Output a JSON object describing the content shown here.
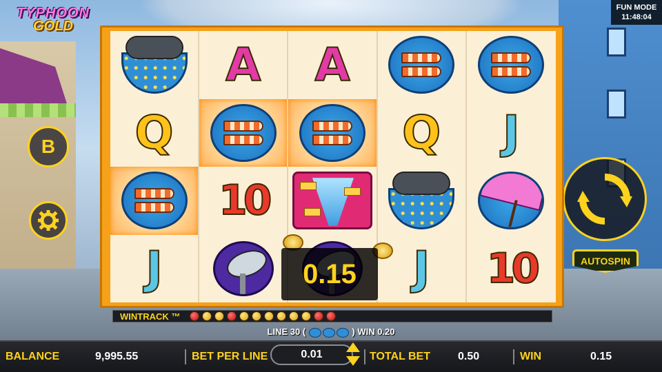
{
  "game": {
    "logo_line1": "TYPHOON",
    "logo_line2": "GOLD"
  },
  "status": {
    "mode": "FUN MODE",
    "clock": "11:48:04"
  },
  "buttons": {
    "b_label": "B",
    "autospin_label": "AUTOSPIN"
  },
  "reels": {
    "columns": 5,
    "rows": 4,
    "grid": [
      [
        "storm-cloud",
        "A",
        "A",
        "windsock",
        "windsock"
      ],
      [
        "Q",
        "windsock",
        "windsock",
        "Q",
        "J"
      ],
      [
        "windsock",
        "10",
        "tornado",
        "storm-cloud",
        "umbrella"
      ],
      [
        "J",
        "satellite-dish",
        "satellite-dish",
        "J",
        "10"
      ]
    ],
    "winning_cells": [
      [
        1,
        1
      ],
      [
        1,
        2
      ],
      [
        2,
        0
      ]
    ]
  },
  "win_popup": {
    "amount": "0.15"
  },
  "wintrack": {
    "label": "WINTRACK ™",
    "dots": [
      "red",
      "gold",
      "gold",
      "red",
      "gold",
      "gold",
      "gold",
      "gold",
      "gold",
      "gold",
      "red",
      "red"
    ]
  },
  "line_info": {
    "prefix": "LINE 30 (",
    "suffix": ") WIN 0.20",
    "symbol_count": 3
  },
  "bottom_bar": {
    "balance_label": "BALANCE",
    "balance_value": "9,995.55",
    "bet_per_line_label": "BET PER LINE",
    "bet_per_line_value": "0.01",
    "total_bet_label": "TOTAL BET",
    "total_bet_value": "0.50",
    "win_label": "WIN",
    "win_value": "0.15"
  },
  "colors": {
    "accent": "#ffd21e",
    "reel_frame": "#f5a11a",
    "win_highlight": "#ff8a00"
  }
}
